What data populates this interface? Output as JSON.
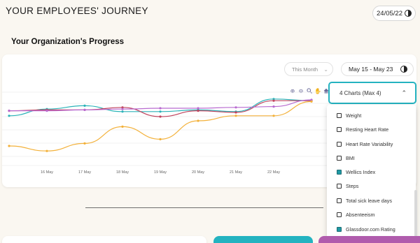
{
  "header": {
    "title": "YOUR EMPLOYEES' JOURNEY",
    "date": "24/05/22"
  },
  "section": {
    "title": "Your Organization's Progress"
  },
  "filters": {
    "period_label": "This Month",
    "date_range": "May 15 - May 23"
  },
  "toolbar_icons": [
    "zoom-in-icon",
    "zoom-out-icon",
    "magnify-icon",
    "pan-hand-icon",
    "home-icon"
  ],
  "dropdown": {
    "label": "4 Charts (Max 4)",
    "items": [
      {
        "label": "Weight",
        "checked": false
      },
      {
        "label": "Resting Heart Rate",
        "checked": false
      },
      {
        "label": "Heart Rate Variability",
        "checked": false
      },
      {
        "label": "BMI",
        "checked": false
      },
      {
        "label": "Wellics Index",
        "checked": true
      },
      {
        "label": "Steps",
        "checked": false
      },
      {
        "label": "Total sick leave days",
        "checked": false
      },
      {
        "label": "Absenteeism",
        "checked": false
      },
      {
        "label": "Glassdoor.com Rating",
        "checked": true
      }
    ]
  },
  "colors": {
    "accent": "#24b3c0",
    "series_teal": "#2bb3b8",
    "series_red": "#c0445e",
    "series_purple": "#b86bd0",
    "series_orange": "#f3b13a",
    "pink_block": "#b05cad"
  },
  "chart_data": {
    "type": "line",
    "x": [
      "15 May",
      "16 May",
      "17 May",
      "18 May",
      "19 May",
      "20 May",
      "21 May",
      "22 May",
      "23 May"
    ],
    "x_tick_labels": [
      "16 May",
      "17 May",
      "18 May",
      "19 May",
      "20 May",
      "21 May",
      "22 May"
    ],
    "ylim": [
      0,
      100
    ],
    "grid": true,
    "legend": "none",
    "series": [
      {
        "color": "#2bb3b8",
        "values": [
          66,
          74,
          78,
          71,
          71,
          73,
          71,
          86,
          84
        ]
      },
      {
        "color": "#c0445e",
        "values": [
          72,
          73,
          73,
          76,
          65,
          72,
          70,
          84,
          84
        ]
      },
      {
        "color": "#b86bd0",
        "values": [
          72,
          72,
          73,
          74,
          75,
          75,
          76,
          77,
          85
        ]
      },
      {
        "color": "#f3b13a",
        "values": [
          30,
          24,
          33,
          53,
          38,
          60,
          66,
          66,
          83
        ]
      }
    ]
  }
}
